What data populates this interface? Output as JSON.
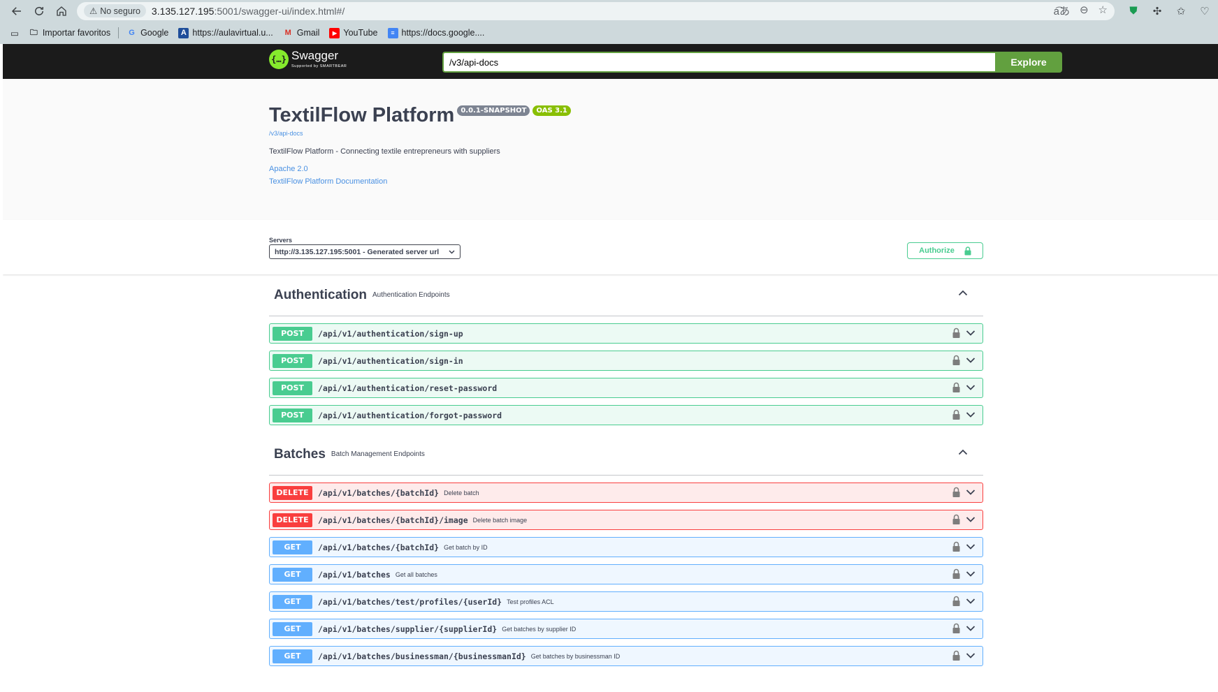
{
  "browser": {
    "security_label": "No seguro",
    "url_host": "3.135.127.195",
    "url_path": ":5001/swagger-ui/index.html#/",
    "bookmarks": [
      {
        "label": "Importar favoritos",
        "icon": "folder-icon"
      },
      {
        "label": "Google",
        "icon": "google-icon"
      },
      {
        "label": "https://aulavirtual.u...",
        "icon": "aulavirtual-icon"
      },
      {
        "label": "Gmail",
        "icon": "gmail-icon"
      },
      {
        "label": "YouTube",
        "icon": "youtube-icon"
      },
      {
        "label": "https://docs.google....",
        "icon": "docs-icon"
      }
    ]
  },
  "topbar": {
    "logo_text": "Swagger",
    "logo_sub": "Supported by SMARTBEAR",
    "explore_value": "/v3/api-docs",
    "explore_label": "Explore"
  },
  "info": {
    "title": "TextilFlow Platform",
    "version": "0.0.1-SNAPSHOT",
    "oas": "OAS 3.1",
    "api_url": "/v3/api-docs",
    "description": "TextilFlow Platform - Connecting textile entrepreneurs with suppliers",
    "license": "Apache 2.0",
    "docs_link": "TextilFlow Platform Documentation"
  },
  "servers": {
    "label": "Servers",
    "selected": "http://3.135.127.195:5001 - Generated server url",
    "authorize_label": "Authorize"
  },
  "tags": [
    {
      "name": "Authentication",
      "description": "Authentication Endpoints",
      "operations": [
        {
          "method": "POST",
          "path": "/api/v1/authentication/sign-up",
          "summary": ""
        },
        {
          "method": "POST",
          "path": "/api/v1/authentication/sign-in",
          "summary": ""
        },
        {
          "method": "POST",
          "path": "/api/v1/authentication/reset-password",
          "summary": ""
        },
        {
          "method": "POST",
          "path": "/api/v1/authentication/forgot-password",
          "summary": ""
        }
      ]
    },
    {
      "name": "Batches",
      "description": "Batch Management Endpoints",
      "operations": [
        {
          "method": "DELETE",
          "path": "/api/v1/batches/{batchId}",
          "summary": "Delete batch"
        },
        {
          "method": "DELETE",
          "path": "/api/v1/batches/{batchId}/image",
          "summary": "Delete batch image"
        },
        {
          "method": "GET",
          "path": "/api/v1/batches/{batchId}",
          "summary": "Get batch by ID"
        },
        {
          "method": "GET",
          "path": "/api/v1/batches",
          "summary": "Get all batches"
        },
        {
          "method": "GET",
          "path": "/api/v1/batches/test/profiles/{userId}",
          "summary": "Test profiles ACL"
        },
        {
          "method": "GET",
          "path": "/api/v1/batches/supplier/{supplierId}",
          "summary": "Get batches by supplier ID"
        },
        {
          "method": "GET",
          "path": "/api/v1/batches/businessman/{businessmanId}",
          "summary": "Get batches by businessman ID"
        }
      ]
    }
  ],
  "colors": {
    "post": "#49cc90",
    "delete": "#f93e3e",
    "get": "#61affe",
    "explore": "#62a03f",
    "topbar": "#1b1b1b"
  }
}
